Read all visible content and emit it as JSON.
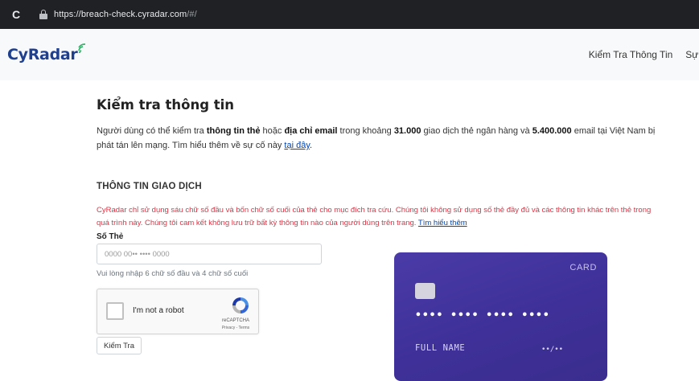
{
  "browser": {
    "url_host": "https://breach-check.cyradar.com",
    "url_path": "/#/"
  },
  "navbar": {
    "logo": "CyRadar",
    "links": [
      "Kiểm Tra Thông Tin",
      "Sự Cố"
    ]
  },
  "main": {
    "title": "Kiểm tra thông tin",
    "intro": {
      "t1": "Người dùng có thể kiểm tra ",
      "b1": "thông tin thẻ",
      "t2": " hoặc ",
      "b2": "địa chỉ email",
      "t3": " trong khoảng ",
      "b3": "31.000",
      "t4": " giao dịch thẻ ngân hàng và ",
      "b4": "5.400.000",
      "t5": " email tại Việt Nam bị phát tán lên mạng. Tìm hiểu thêm về sự cố này ",
      "link": "tại đây",
      "t6": "."
    },
    "section_title": "THÔNG TIN GIAO DỊCH",
    "notice": {
      "text": "CyRadar chỉ sử dụng sáu chữ số đầu và bốn chữ số cuối của thẻ cho mục đích tra cứu. Chúng tôi không sử dụng số thẻ đầy đủ và các thông tin khác trên thẻ trong quá trình này. Chúng tôi cam kết không lưu trữ bất kỳ thông tin nào của người dùng trên trang. ",
      "link": "Tìm hiểu thêm"
    },
    "form": {
      "label": "Số Thẻ",
      "placeholder": "0000 00•• •••• 0000",
      "value": "",
      "hint": "Vui lòng nhập 6 chữ số đầu và 4 chữ số cuối",
      "submit": "Kiểm Tra"
    },
    "recaptcha": {
      "label": "I'm not a robot",
      "brand": "reCAPTCHA",
      "terms": "Privacy - Terms",
      "checked": false
    },
    "card": {
      "label": "CARD",
      "number": "•••• •••• •••• ••••",
      "holder": "FULL NAME",
      "expiry": "••/••",
      "colors": {
        "top": "#4a3ba8",
        "bottom": "#3a2d8e"
      }
    }
  },
  "colors": {
    "brand": "#1f3f8f",
    "notice": "#dc3545",
    "link": "#0645ad"
  }
}
